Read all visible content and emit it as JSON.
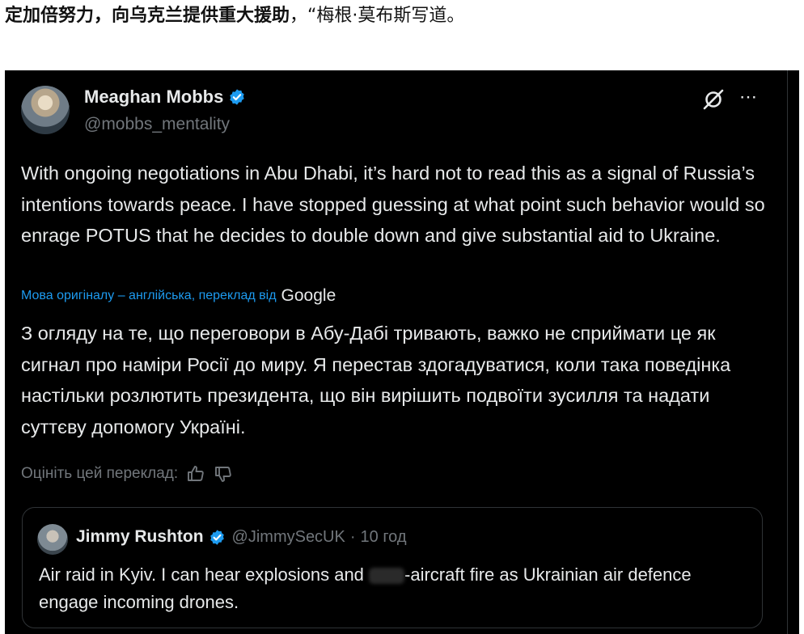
{
  "headline": {
    "bold": "定加倍努力，向乌克兰提供重大援助",
    "rest": "，“梅根·莫布斯写道。"
  },
  "post": {
    "author_name": "Meaghan Mobbs",
    "handle": "@mobbs_mentality",
    "text": "With ongoing negotiations in Abu Dhabi, it’s hard not to read this as a signal of Russia’s intentions towards peace. I have stopped guessing at what point such behavior would so enrage POTUS that he decides to double down and give substantial aid to Ukraine.",
    "translation_label": "Мова оригіналу – англійська, переклад від",
    "translation_provider": "Google",
    "translated_text": "З огляду на те, що переговори в Абу-Дабі тривають, важко не сприймати це як сигнал про наміри Росії до миру. Я перестав здогадуватися, коли така поведінка настільки розлютить президента, що він вирішить подвоїти зусилля та надати суттєву допомогу Україні.",
    "rate_label": "Оцініть цей переклад:",
    "more_icon": "⋯"
  },
  "quote": {
    "author_name": "Jimmy Rushton",
    "handle": "@JimmySecUK",
    "separator": "·",
    "time": "10 год",
    "text_before_blur": "Air raid in Kyiv. I can hear explosions and ",
    "text_after_blur": "-aircraft fire as Ukrainian air defence engage incoming drones."
  },
  "colors": {
    "background": "#000000",
    "text": "#e7e9ea",
    "secondary": "#71767b",
    "link": "#1d9bf0",
    "verified": "#1d9bf0"
  }
}
